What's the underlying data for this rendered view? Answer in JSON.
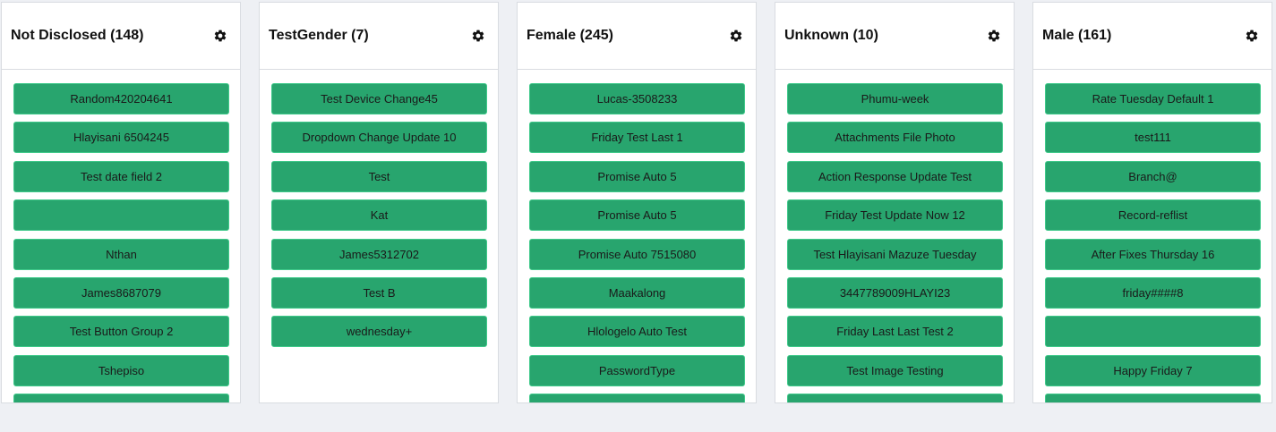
{
  "columns": [
    {
      "title": "Not Disclosed (148)",
      "cards": [
        "Random420204641",
        "Hlayisani 6504245",
        "Test date field 2",
        "",
        "Nthan",
        "James8687079",
        "Test Button Group 2",
        "Tshepiso",
        ""
      ]
    },
    {
      "title": "TestGender (7)",
      "cards": [
        "Test Device Change45",
        "Dropdown Change Update 10",
        "Test",
        "Kat",
        "James5312702",
        "Test B",
        "wednesday+"
      ]
    },
    {
      "title": "Female (245)",
      "cards": [
        "Lucas-3508233",
        "Friday Test Last 1",
        "Promise Auto 5",
        "Promise Auto 5",
        "Promise Auto 7515080",
        "Maakalong",
        "Hlologelo Auto Test",
        "PasswordType",
        ""
      ]
    },
    {
      "title": "Unknown (10)",
      "cards": [
        "Phumu-week",
        "Attachments File Photo",
        "Action Response Update Test",
        "Friday Test Update Now 12",
        "Test Hlayisani Mazuze Tuesday",
        "3447789009HLAYI23",
        "Friday Last Last Test 2",
        "Test Image Testing",
        ""
      ]
    },
    {
      "title": "Male (161)",
      "cards": [
        "Rate Tuesday Default 1",
        "test111",
        "Branch@",
        "Record-reflist",
        "After Fixes Thursday 16",
        "friday####8",
        "",
        "Happy Friday 7",
        ""
      ]
    }
  ],
  "icons": {
    "column_settings": "gear-icon"
  },
  "colors": {
    "card_background": "#28a56e",
    "card_border": "#3fc98a",
    "page_background": "#eef0f4"
  }
}
